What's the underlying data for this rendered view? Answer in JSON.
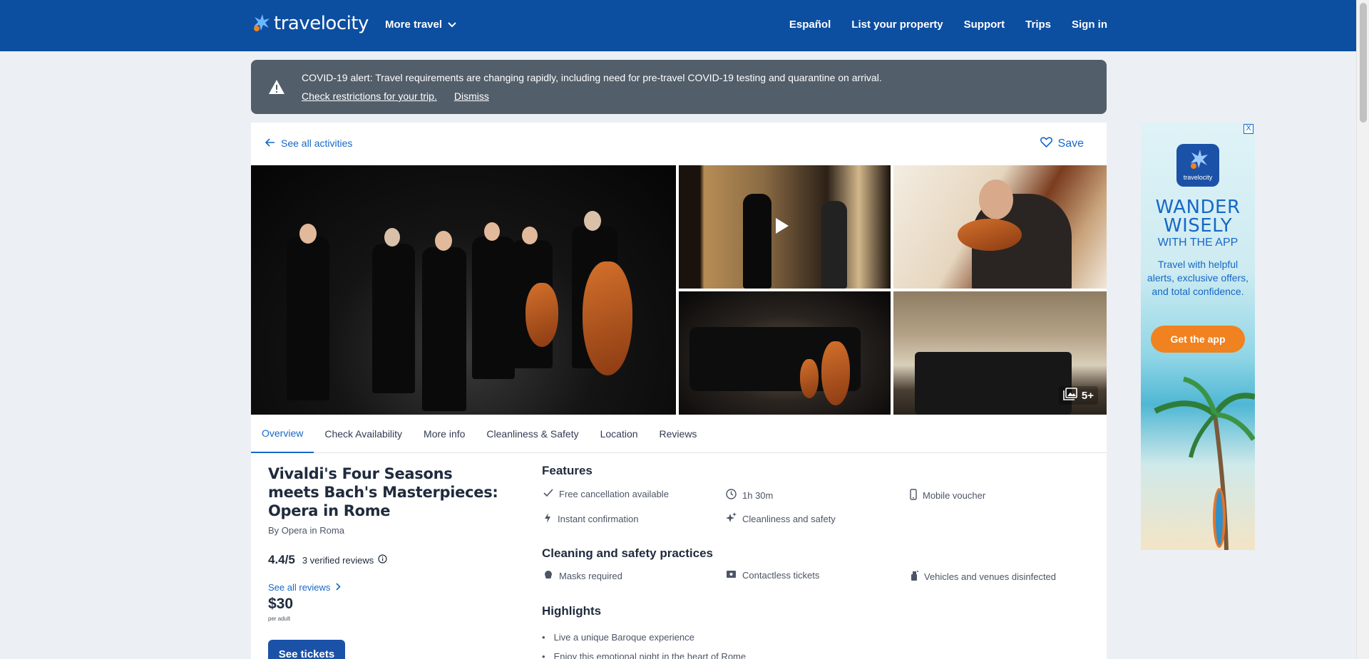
{
  "header": {
    "brand": "travelocity",
    "more_travel": "More travel",
    "nav": [
      "Español",
      "List your property",
      "Support",
      "Trips",
      "Sign in"
    ]
  },
  "covid": {
    "text": "COVID-19 alert: Travel requirements are changing rapidly, including need for pre-travel COVID-19 testing and quarantine on arrival.",
    "check_link": "Check restrictions for your trip.",
    "dismiss": "Dismiss"
  },
  "top": {
    "back": "See all activities",
    "save": "Save"
  },
  "gallery": {
    "more_count": "5+"
  },
  "tabs": [
    "Overview",
    "Check Availability",
    "More info",
    "Cleanliness & Safety",
    "Location",
    "Reviews"
  ],
  "activity": {
    "title": "Vivaldi's Four Seasons meets Bach's Masterpieces: Opera in Rome",
    "by": "By Opera in Roma",
    "rating": "4.4/5",
    "reviews": "3 verified reviews",
    "see_all_reviews": "See all reviews",
    "price": "$30",
    "per": "per adult",
    "see_tickets": "See tickets"
  },
  "features": {
    "heading": "Features",
    "items": [
      "Free cancellation available",
      "1h 30m",
      "Mobile voucher",
      "Instant confirmation",
      "Cleanliness and safety"
    ]
  },
  "cleaning": {
    "heading": "Cleaning and safety practices",
    "items": [
      "Masks required",
      "Contactless tickets",
      "Vehicles and venues disinfected"
    ]
  },
  "highlights": {
    "heading": "Highlights",
    "items": [
      "Live a unique Baroque experience",
      "Enjoy this emotional night in the heart of Rome"
    ]
  },
  "ad": {
    "close": "X",
    "logo_text": "travelocity",
    "headline": "WANDER WISELY",
    "subhead": "WITH THE APP",
    "body": "Travel with helpful alerts, exclusive offers, and total confidence.",
    "cta": "Get the app"
  },
  "colors": {
    "brand_blue": "#0c4ea0",
    "link_blue": "#1668c7",
    "banner_gray": "#525e6a",
    "cta_orange": "#f08220"
  }
}
